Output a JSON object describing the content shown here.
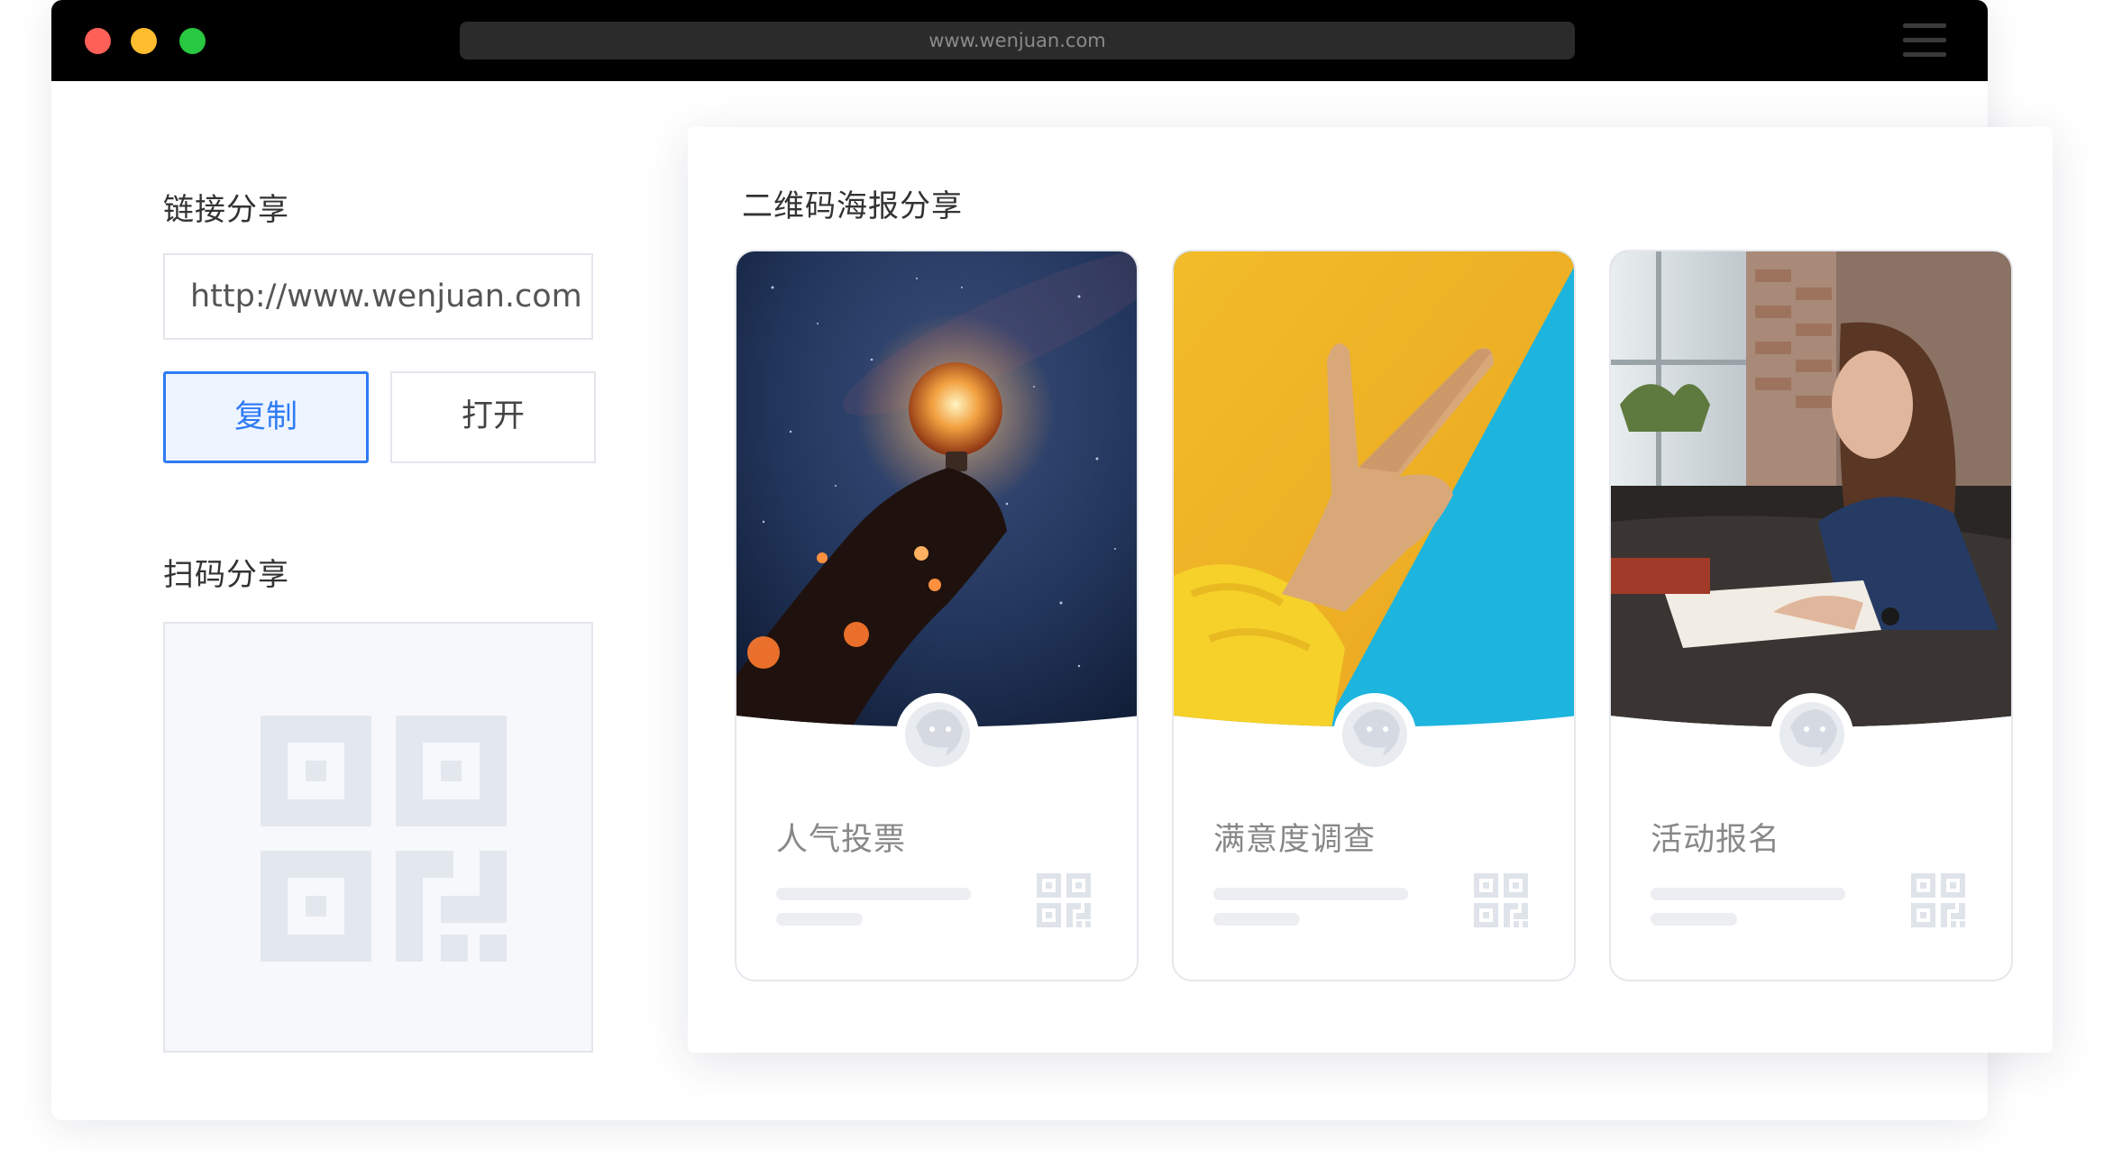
{
  "browser": {
    "url": "www.wenjuan.com"
  },
  "link_share": {
    "title": "链接分享",
    "url_value": "http://www.wenjuan.com",
    "copy_label": "复制",
    "open_label": "打开"
  },
  "qr_share": {
    "title": "扫码分享"
  },
  "poster_share": {
    "title": "二维码海报分享",
    "cards": [
      {
        "label": "人气投票",
        "image": "lightbulb-galaxy-photo"
      },
      {
        "label": "满意度调查",
        "image": "peace-hand-photo"
      },
      {
        "label": "活动报名",
        "image": "woman-writing-photo"
      }
    ]
  },
  "colors": {
    "accent": "#2f7bf5",
    "titlebar": "#000000",
    "traffic_red": "#fe5f57",
    "traffic_yellow": "#febc2e",
    "traffic_green": "#28c840",
    "placeholder": "#e3e7ee"
  },
  "icons": [
    "close-dot",
    "minimize-dot",
    "maximize-dot",
    "hamburger-menu-icon",
    "qr-code-icon",
    "avatar-icon"
  ]
}
